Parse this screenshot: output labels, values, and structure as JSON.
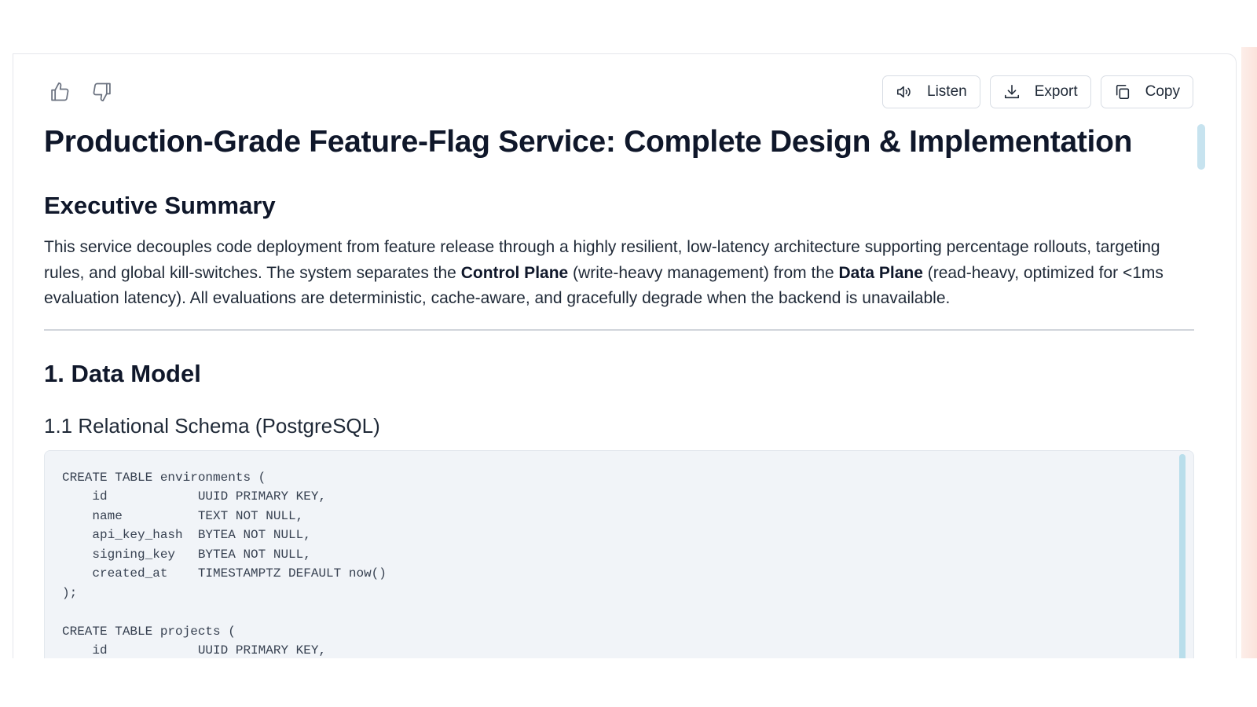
{
  "toolbar": {
    "thumbs_up_icon": "thumbs-up-icon",
    "thumbs_down_icon": "thumbs-down-icon",
    "listen_label": "Listen",
    "export_label": "Export",
    "copy_label": "Copy"
  },
  "document": {
    "title": "Production-Grade Feature-Flag Service: Complete Design & Implementation",
    "summary_heading": "Executive Summary",
    "summary": {
      "part1": "This service decouples code deployment from feature release through a highly resilient, low-latency architecture supporting percentage rollouts, targeting rules, and global kill-switches. The system separates the ",
      "bold1": "Control Plane",
      "part2": " (write-heavy management) from the ",
      "bold2": "Data Plane",
      "part3": " (read-heavy, optimized for <1ms evaluation latency). All evaluations are deterministic, cache-aware, and gracefully degrade when the backend is unavailable."
    },
    "section1_heading": "1. Data Model",
    "section1_1_heading": "1.1 Relational Schema (PostgreSQL)",
    "code_lines": [
      "CREATE TABLE environments (",
      "    id            UUID PRIMARY KEY,",
      "    name          TEXT NOT NULL,",
      "    api_key_hash  BYTEA NOT NULL,",
      "    signing_key   BYTEA NOT NULL,",
      "    created_at    TIMESTAMPTZ DEFAULT now()",
      ");",
      "",
      "CREATE TABLE projects (",
      "    id            UUID PRIMARY KEY,"
    ]
  },
  "colors": {
    "heading": "#0f172a",
    "body_text": "#1f2937",
    "code_bg": "#f1f4f8",
    "scrollbar": "#c7e3ef"
  }
}
